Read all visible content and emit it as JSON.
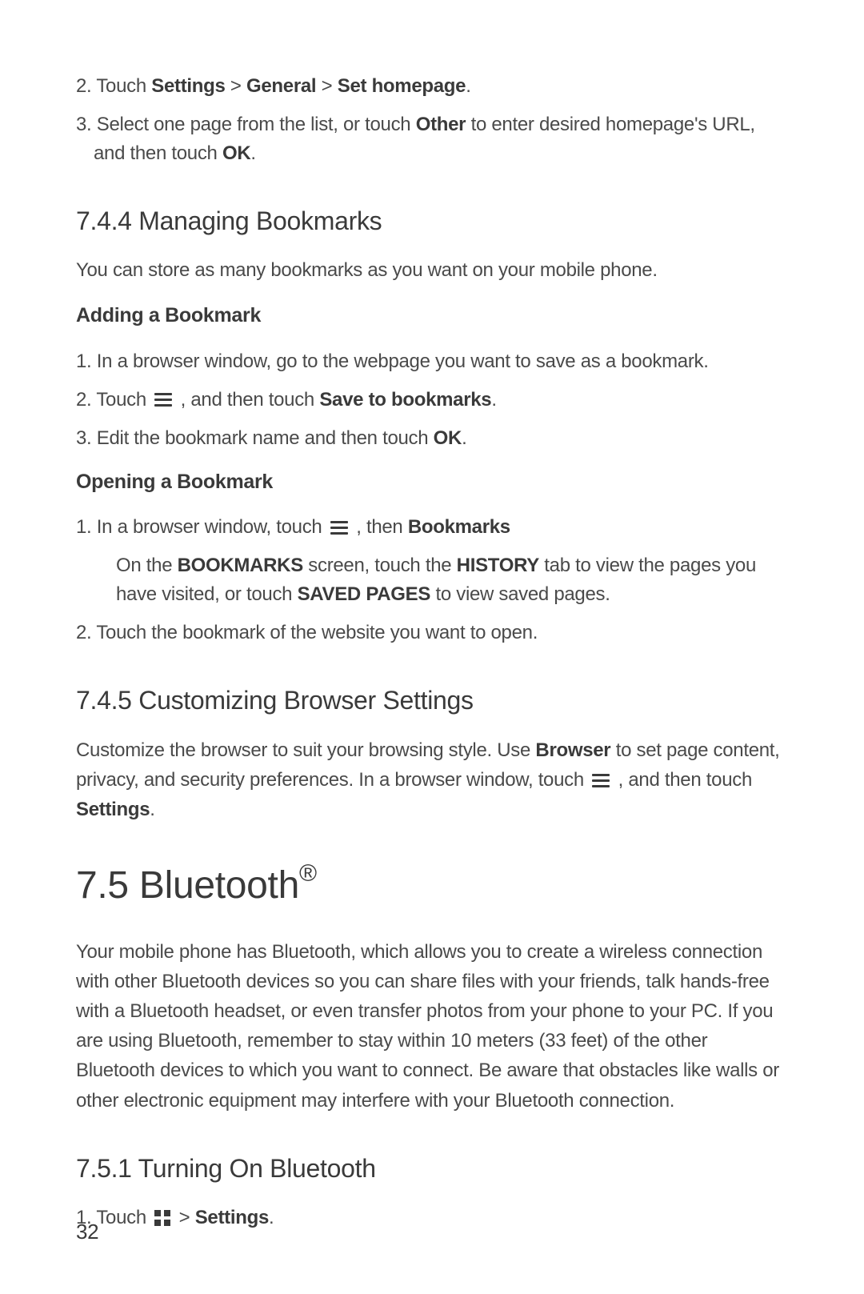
{
  "steps_top": [
    {
      "num": "2.",
      "pre": "Touch ",
      "b1": "Settings",
      "mid1": " > ",
      "b2": "General",
      "mid2": " > ",
      "b3": "Set homepage",
      "post": "."
    },
    {
      "num": "3.",
      "pre": "Select one page from the list, or touch ",
      "b1": "Other",
      "mid1": " to enter desired homepage's URL, and then touch ",
      "b2": "OK",
      "post": "."
    }
  ],
  "h744": "7.4.4  Managing Bookmarks",
  "intro744": "You can store as many bookmarks as you want on your mobile phone.",
  "sub_add": "Adding a Bookmark",
  "add_steps": {
    "s1": "1. In a browser window, go to the webpage you want to save as a bookmark.",
    "s2_pre": "2. Touch ",
    "s2_mid": " , and then touch ",
    "s2_bold": "Save to bookmarks",
    "s2_post": ".",
    "s3_pre": "3. Edit the bookmark name and then touch ",
    "s3_bold": "OK",
    "s3_post": "."
  },
  "sub_open": "Opening a Bookmark",
  "open_steps": {
    "s1_pre": "1. In a browser window, touch ",
    "s1_mid": " , then ",
    "s1_bold": "Bookmarks",
    "note_pre": "On the ",
    "note_b1": "BOOKMARKS",
    "note_mid1": " screen, touch the ",
    "note_b2": "HISTORY",
    "note_mid2": " tab to view the pages you have visited, or touch ",
    "note_b3": "SAVED PAGES",
    "note_post": " to view saved pages.",
    "s2": "2. Touch the bookmark of the website you want to open."
  },
  "h745": "7.4.5  Customizing Browser Settings",
  "text745_pre": "Customize the browser to suit your browsing style. Use ",
  "text745_b1": "Browser",
  "text745_mid1": " to set page content, privacy, and security preferences. In a browser window, touch ",
  "text745_mid2": " , and then touch ",
  "text745_b2": "Settings",
  "text745_post": ".",
  "h75_pre": "7.5  Bluetooth",
  "h75_sup": "®",
  "body75": "Your mobile phone has Bluetooth, which allows you to create a wireless connection with other Bluetooth devices so you can share files with your friends, talk hands-free with a Bluetooth headset, or even transfer photos from your phone to your PC. If you are using Bluetooth, remember to stay within 10 meters (33 feet) of the other Bluetooth devices to which you want to connect. Be aware that obstacles like walls or other electronic equipment may interfere with your Bluetooth connection.",
  "h751": "7.5.1  Turning On Bluetooth",
  "s751_pre": "1. Touch ",
  "s751_mid": " > ",
  "s751_bold": "Settings",
  "s751_post": ".",
  "page_num": "32"
}
